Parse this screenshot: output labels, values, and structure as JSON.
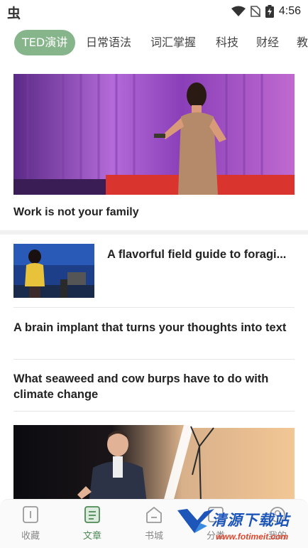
{
  "status_bar": {
    "app_glyph": "虫",
    "time": "4:56"
  },
  "tabs": [
    {
      "label": "TED演讲",
      "active": true
    },
    {
      "label": "日常语法",
      "active": false
    },
    {
      "label": "词汇掌握",
      "active": false
    },
    {
      "label": "科技",
      "active": false
    },
    {
      "label": "财经",
      "active": false
    },
    {
      "label": "教",
      "active": false
    }
  ],
  "feed": {
    "hero": {
      "title": "Work is not your family"
    },
    "thumb_item": {
      "title": "A flavorful field guide to foragi..."
    },
    "items": [
      {
        "title": "A brain implant that turns your thoughts into text"
      },
      {
        "title": "What seaweed and cow burps have to do with climate change"
      }
    ]
  },
  "bottom_nav": [
    {
      "label": "收藏",
      "icon": "bookmark-icon",
      "active": false
    },
    {
      "label": "文章",
      "icon": "article-icon",
      "active": true
    },
    {
      "label": "书城",
      "icon": "bookstore-icon",
      "active": false
    },
    {
      "label": "分类",
      "icon": "category-icon",
      "active": false
    },
    {
      "label": "我的",
      "icon": "profile-icon",
      "active": false
    }
  ],
  "watermark": {
    "text": "清源下载站",
    "url": "www.fotimeit.com"
  },
  "colors": {
    "accent": "#86b58b",
    "active_nav": "#4e8a56"
  }
}
